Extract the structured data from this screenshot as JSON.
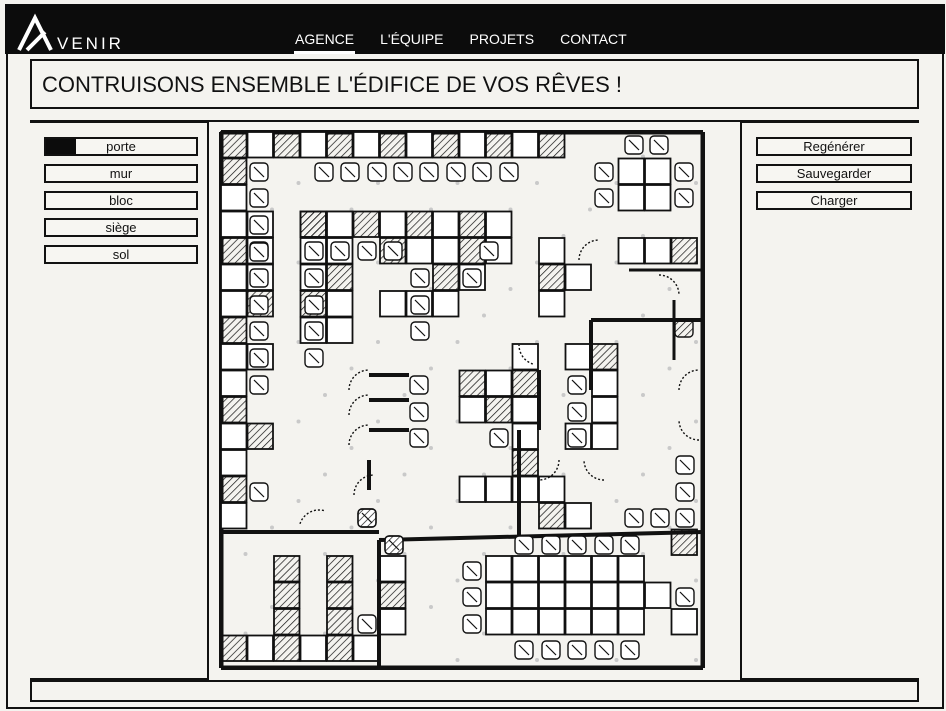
{
  "brand": {
    "name": "VENIR",
    "mark_letter": "A"
  },
  "nav": {
    "items": [
      "AGENCE",
      "L'ÉQUIPE",
      "PROJETS",
      "CONTACT"
    ],
    "active": "AGENCE"
  },
  "title": "CONTRUISONS ENSEMBLE L'ÉDIFICE DE VOS RÊVES !",
  "tools": [
    "porte",
    "mur",
    "bloc",
    "siège",
    "sol"
  ],
  "selected_tool": "porte",
  "actions": [
    "Regénérer",
    "Sauvegarder",
    "Charger"
  ],
  "icons": [
    "logo-mark-icon",
    "floor-plan-canvas"
  ],
  "colors": {
    "bar": "#0c0c0c",
    "paper": "#f4f3ef",
    "ink": "#111111"
  }
}
